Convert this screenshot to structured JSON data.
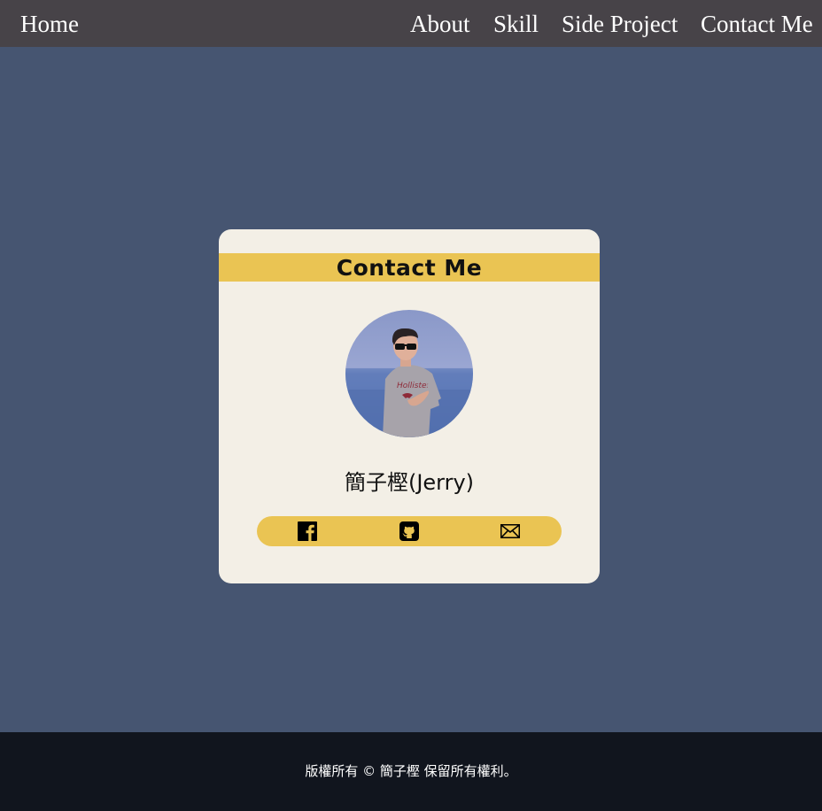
{
  "nav": {
    "home": "Home",
    "about": "About",
    "skill": "Skill",
    "side_project": "Side Project",
    "contact": "Contact Me"
  },
  "card": {
    "title": "Contact Me",
    "name": "簡子樫(Jerry)",
    "social": [
      {
        "icon": "facebook-icon"
      },
      {
        "icon": "github-icon"
      },
      {
        "icon": "mail-icon"
      }
    ]
  },
  "footer": {
    "copyright": "版權所有 © 簡子樫 保留所有權利。"
  },
  "colors": {
    "nav_bg": "#474348",
    "page_bg": "#465571",
    "card_bg": "#f3efe6",
    "accent": "#eac453",
    "footer_bg": "#11151e"
  }
}
